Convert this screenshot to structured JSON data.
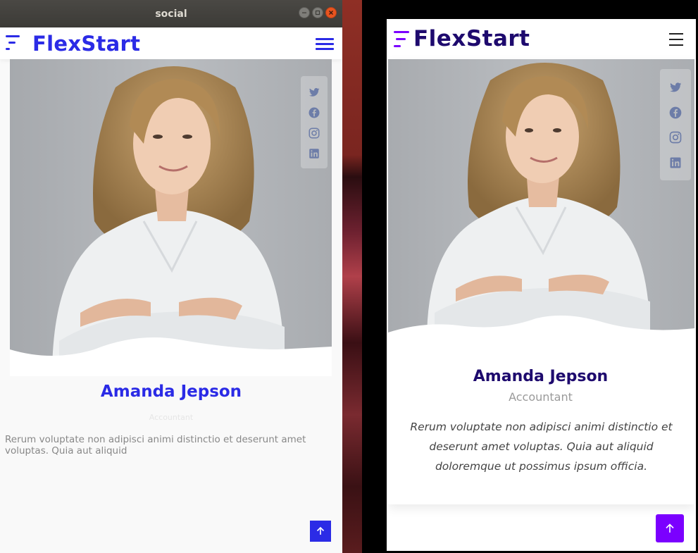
{
  "window_left": {
    "title": "social",
    "brand": "FlexStart",
    "member": {
      "name": "Amanda Jepson",
      "role": "Accountant",
      "description": "Rerum voluptate non adipisci animi distinctio et deserunt amet voluptas. Quia aut aliquid"
    }
  },
  "window_right": {
    "brand": "FlexStart",
    "member": {
      "name": "Amanda Jepson",
      "role": "Accountant",
      "description": "Rerum voluptate non adipisci animi distinctio et deserunt amet voluptas. Quia aut aliquid doloremque ut possimus ipsum officia."
    }
  },
  "social_icons": [
    "twitter-icon",
    "facebook-icon",
    "instagram-icon",
    "linkedin-icon"
  ],
  "colors": {
    "left_accent": "#2b2be6",
    "right_heading": "#1e0a6e",
    "right_accent": "#7b00ff"
  }
}
